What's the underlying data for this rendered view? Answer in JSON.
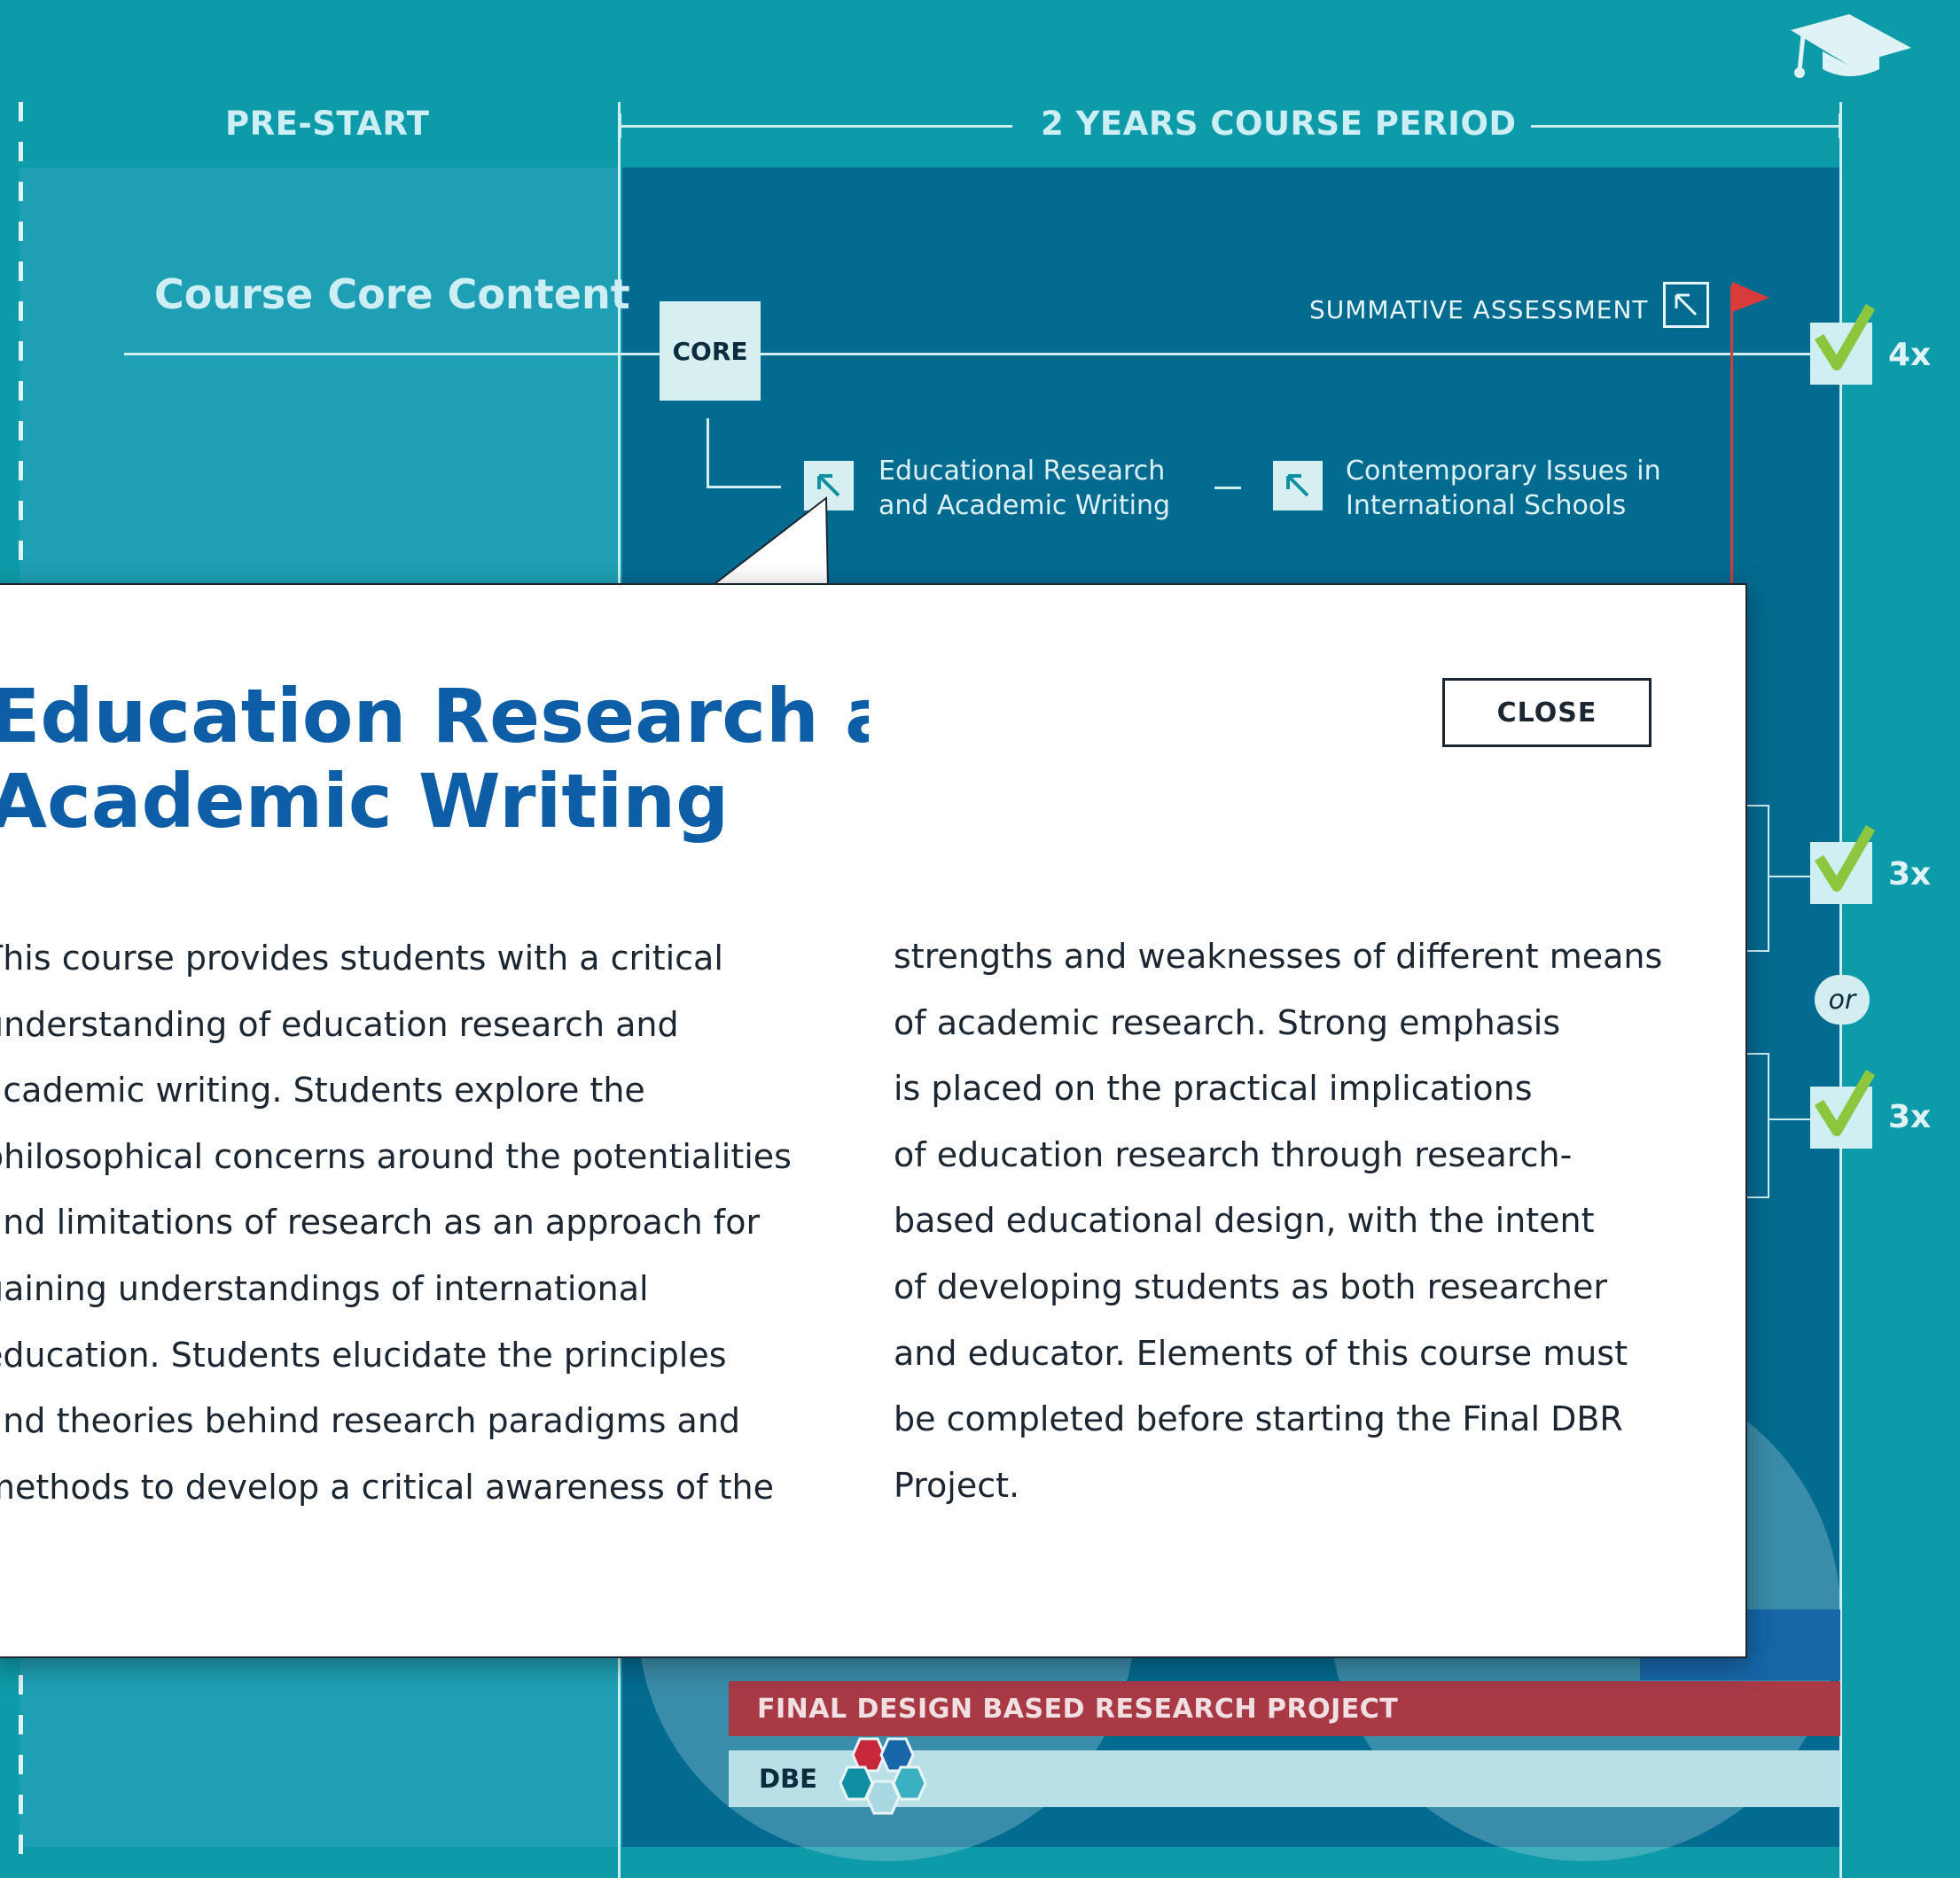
{
  "timeline": {
    "prestart_title": "PRE-START",
    "course_period_title": "2 YEARS COURSE PERIOD",
    "core_content_label": "Course Core Content",
    "core_label": "CORE",
    "summative_label": "SUMMATIVE ASSESSMENT",
    "items": [
      {
        "line1": "Educational Research",
        "line2": "and Academic Writing"
      },
      {
        "line1": "Contemporary Issues in",
        "line2": "International Schools"
      }
    ],
    "counts": [
      "4x",
      "3x",
      "3x"
    ],
    "or_label": "or",
    "final_project": "FINAL DESIGN BASED RESEARCH PROJECT",
    "dbe_label": "DBE"
  },
  "modal": {
    "title_line1": "Education Research and",
    "title_line2": "Academic Writing",
    "close_label": "CLOSE",
    "left_lines": [
      "This course provides students with a critical",
      "understanding of education research and",
      "academic writing. Students explore the",
      "philosophical concerns around the potentialities",
      "and limitations of research as an approach for",
      "gaining understandings of international",
      "education. Students elucidate the principles",
      "and theories behind research paradigms and",
      "methods to develop a critical awareness of the"
    ],
    "right_lines": [
      "strengths and weaknesses of different means",
      "of academic research. Strong emphasis",
      "is placed on the practical implications",
      "of education research through research-",
      "based educational design, with the intent",
      "of developing students as both researcher",
      "and educator. Elements of this course must",
      "be completed before starting the Final DBR",
      "Project."
    ]
  },
  "colors": {
    "background": "#0e9ba9",
    "course_panel": "#046b90",
    "accent_title": "#0d5ea6",
    "final_bar": "#a83a46",
    "check_green": "#8cc63f",
    "flag_red": "#d93a3a"
  }
}
